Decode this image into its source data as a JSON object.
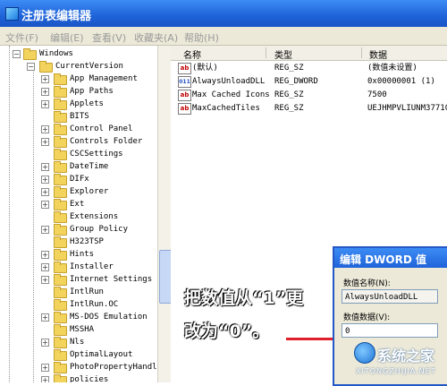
{
  "window": {
    "title": "注册表编辑器"
  },
  "menu": [
    "文件(F)",
    "编辑(E)",
    "查看(V)",
    "收藏夹(A)",
    "帮助(H)"
  ],
  "tree": {
    "root": "Windows",
    "current": "CurrentVersion",
    "items": [
      {
        "label": "App Management",
        "expandable": true
      },
      {
        "label": "App Paths",
        "expandable": true
      },
      {
        "label": "Applets",
        "expandable": true
      },
      {
        "label": "BITS",
        "expandable": false
      },
      {
        "label": "Control Panel",
        "expandable": true
      },
      {
        "label": "Controls Folder",
        "expandable": true
      },
      {
        "label": "CSCSettings",
        "expandable": false
      },
      {
        "label": "DateTime",
        "expandable": true
      },
      {
        "label": "DIFx",
        "expandable": true
      },
      {
        "label": "Explorer",
        "expandable": true
      },
      {
        "label": "Ext",
        "expandable": true
      },
      {
        "label": "Extensions",
        "expandable": false
      },
      {
        "label": "Group Policy",
        "expandable": true
      },
      {
        "label": "H323TSP",
        "expandable": false
      },
      {
        "label": "Hints",
        "expandable": true
      },
      {
        "label": "Installer",
        "expandable": true
      },
      {
        "label": "Internet Settings",
        "expandable": true
      },
      {
        "label": "IntlRun",
        "expandable": false
      },
      {
        "label": "IntlRun.OC",
        "expandable": false
      },
      {
        "label": "MS-DOS Emulation",
        "expandable": true
      },
      {
        "label": "MSSHA",
        "expandable": false
      },
      {
        "label": "Nls",
        "expandable": true
      },
      {
        "label": "OptimalLayout",
        "expandable": false
      },
      {
        "label": "PhotoPropertyHandle",
        "expandable": true
      },
      {
        "label": "policies",
        "expandable": true
      }
    ]
  },
  "list": {
    "headers": {
      "name": "名称",
      "type": "类型",
      "data": "数据"
    },
    "rows": [
      {
        "icon": "ab",
        "name": "(默认)",
        "type": "REG_SZ",
        "data": "(数值未设置)"
      },
      {
        "icon": "bin",
        "name": "AlwaysUnloadDLL",
        "type": "REG_DWORD",
        "data": "0x00000001 (1)"
      },
      {
        "icon": "ab",
        "name": "Max Cached Icons",
        "type": "REG_SZ",
        "data": "7500"
      },
      {
        "icon": "ab",
        "name": "MaxCachedTiles",
        "type": "REG_SZ",
        "data": "UEJHMPVLIUNM37710"
      }
    ]
  },
  "dialog": {
    "title": "编辑 DWORD 值",
    "name_label": "数值名称(N):",
    "name_value": "AlwaysUnloadDLL",
    "data_label": "数值数据(V):",
    "data_value": "0"
  },
  "annotation": {
    "line1": "把数值从“1”更",
    "line2": "改为“0”。"
  },
  "watermark": {
    "text": "系统之家",
    "url": "XITONGZHIJIA.NET"
  },
  "colors": {
    "titlebar": "#1f63d9",
    "annotation_line": "#e0202a"
  }
}
